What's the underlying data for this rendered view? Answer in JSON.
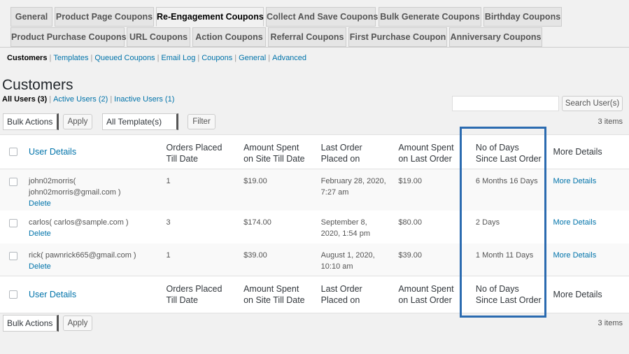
{
  "tabs_row1": [
    "General",
    "Product Page Coupons",
    "Re-Engagement Coupons",
    "Collect And Save Coupons",
    "Bulk Generate Coupons",
    "Birthday Coupons"
  ],
  "tabs_row2": [
    "Product Purchase Coupons",
    "URL Coupons",
    "Action Coupons",
    "Referral Coupons",
    "First Purchase Coupon",
    "Anniversary Coupons"
  ],
  "subnav": [
    "Customers",
    "Templates",
    "Queued Coupons",
    "Email Log",
    "Coupons",
    "General",
    "Advanced"
  ],
  "page_title": "Customers",
  "filters": [
    "All Users (3)",
    "Active Users (2)",
    "Inactive Users (1)"
  ],
  "search_button": "Search User(s)",
  "bulk_actions": "Bulk Actions",
  "apply": "Apply",
  "template_select": "All Template(s)",
  "filter_button": "Filter",
  "items_count": "3 items",
  "columns": [
    "User Details",
    "Orders Placed Till Date",
    "Amount Spent on Site Till Date",
    "Last Order Placed on",
    "Amount Spent on Last Order",
    "No of Days Since Last Order",
    "More Details"
  ],
  "rows": [
    {
      "user": "john02morris( john02morris@gmail.com )",
      "delete": "Delete",
      "orders": "1",
      "spent": "$19.00",
      "last_order": "February 28, 2020, 7:27 am",
      "last_amount": "$19.00",
      "days": "6 Months 16 Days",
      "more": "More Details"
    },
    {
      "user": "carlos( carlos@sample.com )",
      "delete": "Delete",
      "orders": "3",
      "spent": "$174.00",
      "last_order": "September 8, 2020, 1:54 pm",
      "last_amount": "$80.00",
      "days": "2 Days",
      "more": "More Details"
    },
    {
      "user": "rick( pawnrick665@gmail.com )",
      "delete": "Delete",
      "orders": "1",
      "spent": "$39.00",
      "last_order": "August 1, 2020, 10:10 am",
      "last_amount": "$39.00",
      "days": "1 Month 11 Days",
      "more": "More Details"
    }
  ]
}
